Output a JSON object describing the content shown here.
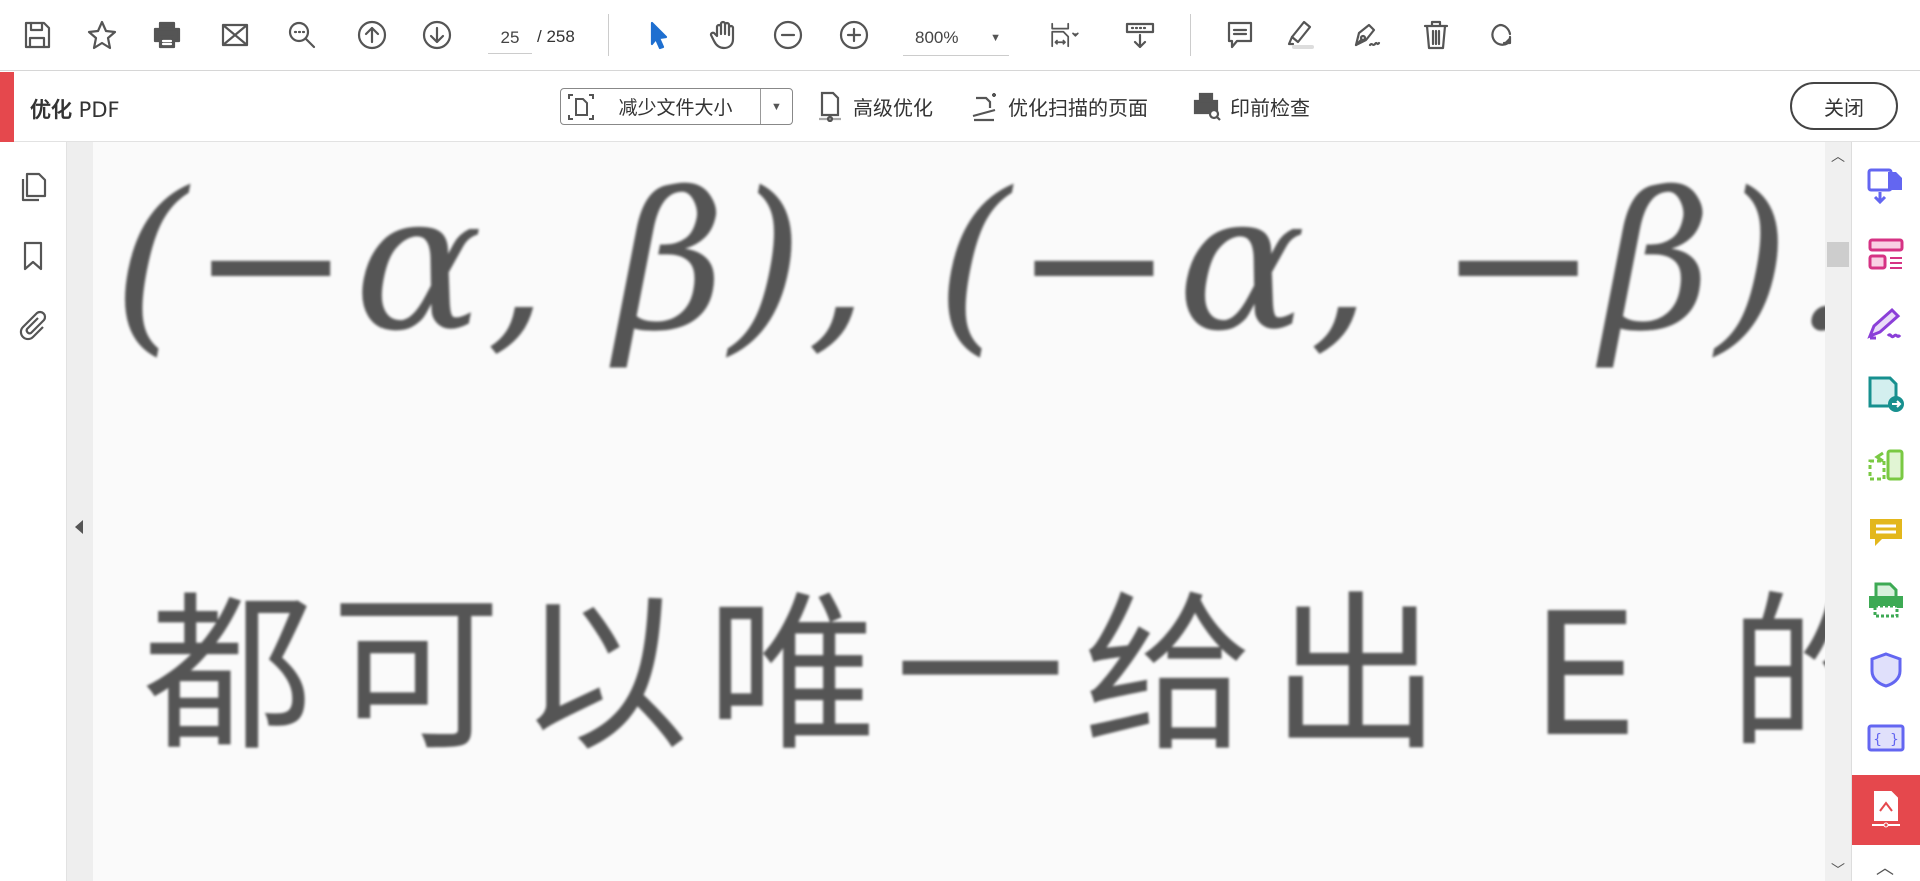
{
  "toolbar": {
    "page_current": "25",
    "page_total": "/ 258",
    "zoom": "800%",
    "icons": [
      "save-icon",
      "star-icon",
      "print-icon",
      "mail-icon",
      "search-icon",
      "page-up-icon",
      "page-down-icon",
      "select-cursor-icon",
      "hand-icon",
      "zoom-out-icon",
      "zoom-in-icon",
      "fit-page-icon",
      "scroll-mode-icon",
      "comment-icon",
      "highlight-icon",
      "sign-icon",
      "trash-icon",
      "rotate-icon"
    ]
  },
  "optimize_bar": {
    "title_bold": "优化",
    "title_rest": " PDF",
    "reduce_size": "减少文件大小",
    "advanced": "高级优化",
    "scanned": "优化扫描的页面",
    "preflight": "印前检查",
    "close": "关闭"
  },
  "document": {
    "line1": "(−α, β), (−α, −β).",
    "line2": "都可以唯一给出 E 的"
  },
  "colors": {
    "accent": "#e5484d",
    "select": "#1e6fd0"
  }
}
